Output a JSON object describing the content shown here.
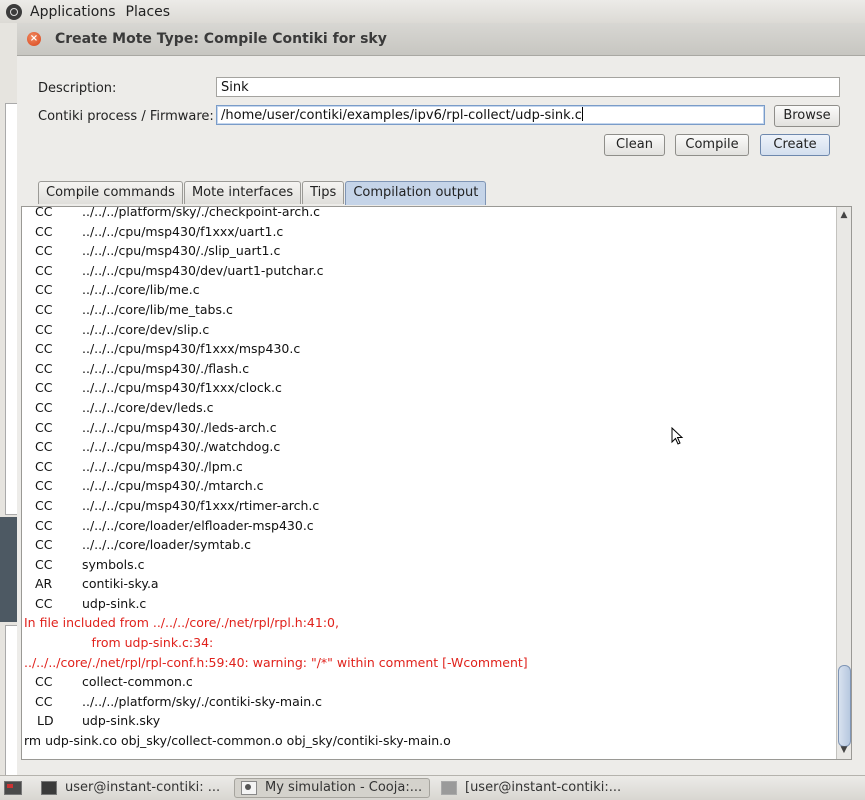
{
  "top_panel": {
    "menus": [
      "Applications",
      "Places"
    ]
  },
  "dialog": {
    "title": "Create Mote Type: Compile Contiki for sky",
    "description_label": "Description:",
    "description_value": "Sink",
    "firmware_label": "Contiki process / Firmware:",
    "firmware_value": "/home/user/contiki/examples/ipv6/rpl-collect/udp-sink.c",
    "buttons": {
      "browse": "Browse",
      "clean": "Clean",
      "compile": "Compile",
      "create": "Create"
    },
    "tabs": [
      "Compile commands",
      "Mote interfaces",
      "Tips",
      "Compilation output"
    ],
    "active_tab": "Compilation output",
    "output": [
      {
        "cmd": "CC",
        "arg": "../../../platform/sky/./checkpoint-arch.c"
      },
      {
        "cmd": "CC",
        "arg": "../../../cpu/msp430/f1xxx/uart1.c"
      },
      {
        "cmd": "CC",
        "arg": "../../../cpu/msp430/./slip_uart1.c"
      },
      {
        "cmd": "CC",
        "arg": "../../../cpu/msp430/dev/uart1-putchar.c"
      },
      {
        "cmd": "CC",
        "arg": "../../../core/lib/me.c"
      },
      {
        "cmd": "CC",
        "arg": "../../../core/lib/me_tabs.c"
      },
      {
        "cmd": "CC",
        "arg": "../../../core/dev/slip.c"
      },
      {
        "cmd": "CC",
        "arg": "../../../cpu/msp430/f1xxx/msp430.c"
      },
      {
        "cmd": "CC",
        "arg": "../../../cpu/msp430/./flash.c"
      },
      {
        "cmd": "CC",
        "arg": "../../../cpu/msp430/f1xxx/clock.c"
      },
      {
        "cmd": "CC",
        "arg": "../../../core/dev/leds.c"
      },
      {
        "cmd": "CC",
        "arg": "../../../cpu/msp430/./leds-arch.c"
      },
      {
        "cmd": "CC",
        "arg": "../../../cpu/msp430/./watchdog.c"
      },
      {
        "cmd": "CC",
        "arg": "../../../cpu/msp430/./lpm.c"
      },
      {
        "cmd": "CC",
        "arg": "../../../cpu/msp430/./mtarch.c"
      },
      {
        "cmd": "CC",
        "arg": "../../../cpu/msp430/f1xxx/rtimer-arch.c"
      },
      {
        "cmd": "CC",
        "arg": "../../../core/loader/elfloader-msp430.c"
      },
      {
        "cmd": "CC",
        "arg": "../../../core/loader/symtab.c"
      },
      {
        "cmd": "CC",
        "arg": "symbols.c"
      },
      {
        "cmd": "AR",
        "arg": "contiki-sky.a"
      },
      {
        "cmd": "CC",
        "arg": "udp-sink.c"
      },
      {
        "err": "In file included from ../../../core/./net/rpl/rpl.h:41:0,"
      },
      {
        "err": "                 from udp-sink.c:34:"
      },
      {
        "err": "../../../core/./net/rpl/rpl-conf.h:59:40: warning: \"/*\" within comment [-Wcomment]"
      },
      {
        "cmd": "CC",
        "arg": "collect-common.c"
      },
      {
        "cmd": "CC",
        "arg": "../../../platform/sky/./contiki-sky-main.c"
      },
      {
        "cmd": "LD",
        "arg": "udp-sink.sky"
      },
      {
        "plain": "rm udp-sink.co obj_sky/collect-common.o obj_sky/contiki-sky-main.o"
      }
    ]
  },
  "taskbar": {
    "tasks": [
      {
        "label": "user@instant-contiki: ...",
        "icon": "terminal-icon"
      },
      {
        "label": "My simulation - Cooja:...",
        "icon": "cooja-icon",
        "active": true
      },
      {
        "label": "[user@instant-contiki:...",
        "icon": "terminal-icon"
      }
    ]
  },
  "colors": {
    "error_text": "#e0221c",
    "active_tab": "#c5d4e8",
    "close_button": "#d9441b"
  }
}
